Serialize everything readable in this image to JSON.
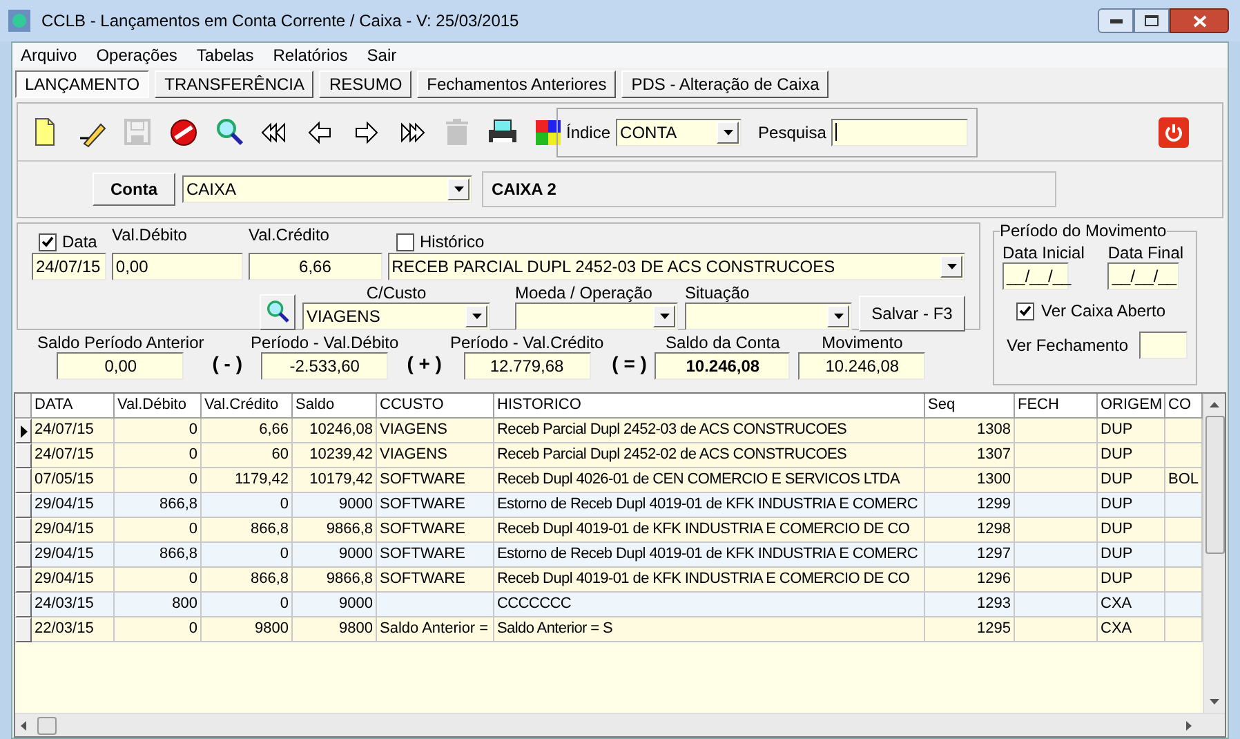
{
  "window": {
    "title": "CCLB - Lançamentos em Conta Corrente / Caixa - V: 25/03/2015"
  },
  "menu": [
    "Arquivo",
    "Operações",
    "Tabelas",
    "Relatórios",
    "Sair"
  ],
  "tabs": [
    {
      "label": "LANÇAMENTO",
      "selected": true
    },
    {
      "label": "TRANSFERÊNCIA",
      "selected": false
    },
    {
      "label": "RESUMO",
      "selected": false
    },
    {
      "label": "Fechamentos Anteriores",
      "selected": false
    },
    {
      "label": "PDS - Alteração de Caixa",
      "selected": false
    }
  ],
  "toolbar": [
    {
      "kind": "new",
      "disabled": false
    },
    {
      "kind": "edit",
      "disabled": false
    },
    {
      "kind": "save",
      "disabled": true
    },
    {
      "kind": "cancel",
      "disabled": false
    },
    {
      "kind": "search",
      "disabled": false
    },
    {
      "kind": "first",
      "disabled": false
    },
    {
      "kind": "prev",
      "disabled": false
    },
    {
      "kind": "next",
      "disabled": false
    },
    {
      "kind": "last",
      "disabled": false
    },
    {
      "kind": "delete",
      "disabled": true
    },
    {
      "kind": "print",
      "disabled": false
    },
    {
      "kind": "puzzle",
      "disabled": false
    }
  ],
  "indice": {
    "label": "Índice",
    "value": "CONTA"
  },
  "pesquisa": {
    "label": "Pesquisa"
  },
  "conta": {
    "button": "Conta",
    "value": "CAIXA",
    "description": "CAIXA 2"
  },
  "entry": {
    "data": {
      "label": "Data",
      "checked": true,
      "value": "24/07/15"
    },
    "val_debito": {
      "label": "Val.Débito",
      "value": "0,00"
    },
    "val_credito": {
      "label": "Val.Crédito",
      "value": "6,66"
    },
    "historico": {
      "label": "Histórico",
      "checked": false,
      "value": "RECEB PARCIAL DUPL 2452-03 DE ACS CONSTRUCOES"
    },
    "ccusto": {
      "label": "C/Custo",
      "value": "VIAGENS"
    },
    "moeda": {
      "label": "Moeda / Operação"
    },
    "situacao": {
      "label": "Situação"
    },
    "save_button": "Salvar - F3"
  },
  "periodo": {
    "title": "Período do Movimento",
    "data_inicial": {
      "label": "Data Inicial",
      "value": "__/__/__"
    },
    "data_final": {
      "label": "Data Final",
      "value": "__/__/__"
    },
    "ver_caixa_aberto": {
      "label": "Ver Caixa Aberto",
      "checked": true
    },
    "ver_fechamento": {
      "label": "Ver Fechamento"
    }
  },
  "totals": [
    {
      "label": "Saldo Período Anterior",
      "value": "0,00",
      "bold": false,
      "operator": "( - )"
    },
    {
      "label": "Período - Val.Débito",
      "value": "-2.533,60",
      "bold": false,
      "operator": "( + )"
    },
    {
      "label": "Período - Val.Crédito",
      "value": "12.779,68",
      "bold": false,
      "operator": "( = )"
    },
    {
      "label": "Saldo da Conta",
      "value": "10.246,08",
      "bold": true
    },
    {
      "label": "Movimento",
      "value": "10.246,08",
      "bold": false
    }
  ],
  "table": {
    "columns": [
      "DATA",
      "Val.Débito",
      "Val.Crédito",
      "Saldo",
      "CCUSTO",
      "HISTORICO",
      "Seq",
      "FECH",
      "ORIGEM",
      "CO"
    ],
    "rows": [
      {
        "kind": "credit",
        "selected": true,
        "cells": [
          "24/07/15",
          "0",
          "6,66",
          "10246,08",
          "VIAGENS",
          "Receb Parcial Dupl 2452-03 de ACS CONSTRUCOES",
          "1308",
          "",
          "DUP",
          ""
        ]
      },
      {
        "kind": "credit",
        "selected": false,
        "cells": [
          "24/07/15",
          "0",
          "60",
          "10239,42",
          "VIAGENS",
          "Receb Parcial Dupl 2452-02 de ACS CONSTRUCOES",
          "1307",
          "",
          "DUP",
          ""
        ]
      },
      {
        "kind": "credit",
        "selected": false,
        "cells": [
          "07/05/15",
          "0",
          "1179,42",
          "10179,42",
          "SOFTWARE",
          "Receb Dupl 4026-01 de CEN COMERCIO E SERVICOS LTDA",
          "1300",
          "",
          "DUP",
          "BOL"
        ]
      },
      {
        "kind": "debit",
        "selected": false,
        "cells": [
          "29/04/15",
          "866,8",
          "0",
          "9000",
          "SOFTWARE",
          "Estorno de Receb Dupl 4019-01 de KFK INDUSTRIA E COMERC",
          "1299",
          "",
          "DUP",
          ""
        ]
      },
      {
        "kind": "credit",
        "selected": false,
        "cells": [
          "29/04/15",
          "0",
          "866,8",
          "9866,8",
          "SOFTWARE",
          "Receb Dupl 4019-01 de KFK INDUSTRIA E COMERCIO DE CO",
          "1298",
          "",
          "DUP",
          ""
        ]
      },
      {
        "kind": "debit",
        "selected": false,
        "cells": [
          "29/04/15",
          "866,8",
          "0",
          "9000",
          "SOFTWARE",
          "Estorno de Receb Dupl 4019-01 de KFK INDUSTRIA E COMERC",
          "1297",
          "",
          "DUP",
          ""
        ]
      },
      {
        "kind": "credit",
        "selected": false,
        "cells": [
          "29/04/15",
          "0",
          "866,8",
          "9866,8",
          "SOFTWARE",
          "Receb Dupl 4019-01 de KFK INDUSTRIA E COMERCIO DE CO",
          "1296",
          "",
          "DUP",
          ""
        ]
      },
      {
        "kind": "debit",
        "selected": false,
        "cells": [
          "24/03/15",
          "800",
          "0",
          "9000",
          "",
          "CCCCCCC",
          "1293",
          "",
          "CXA",
          ""
        ]
      },
      {
        "kind": "credit",
        "selected": false,
        "cells": [
          "22/03/15",
          "0",
          "9800",
          "9800",
          "Saldo Anterior =",
          "Saldo Anterior = S",
          "1295",
          "",
          "CXA",
          ""
        ]
      }
    ]
  }
}
